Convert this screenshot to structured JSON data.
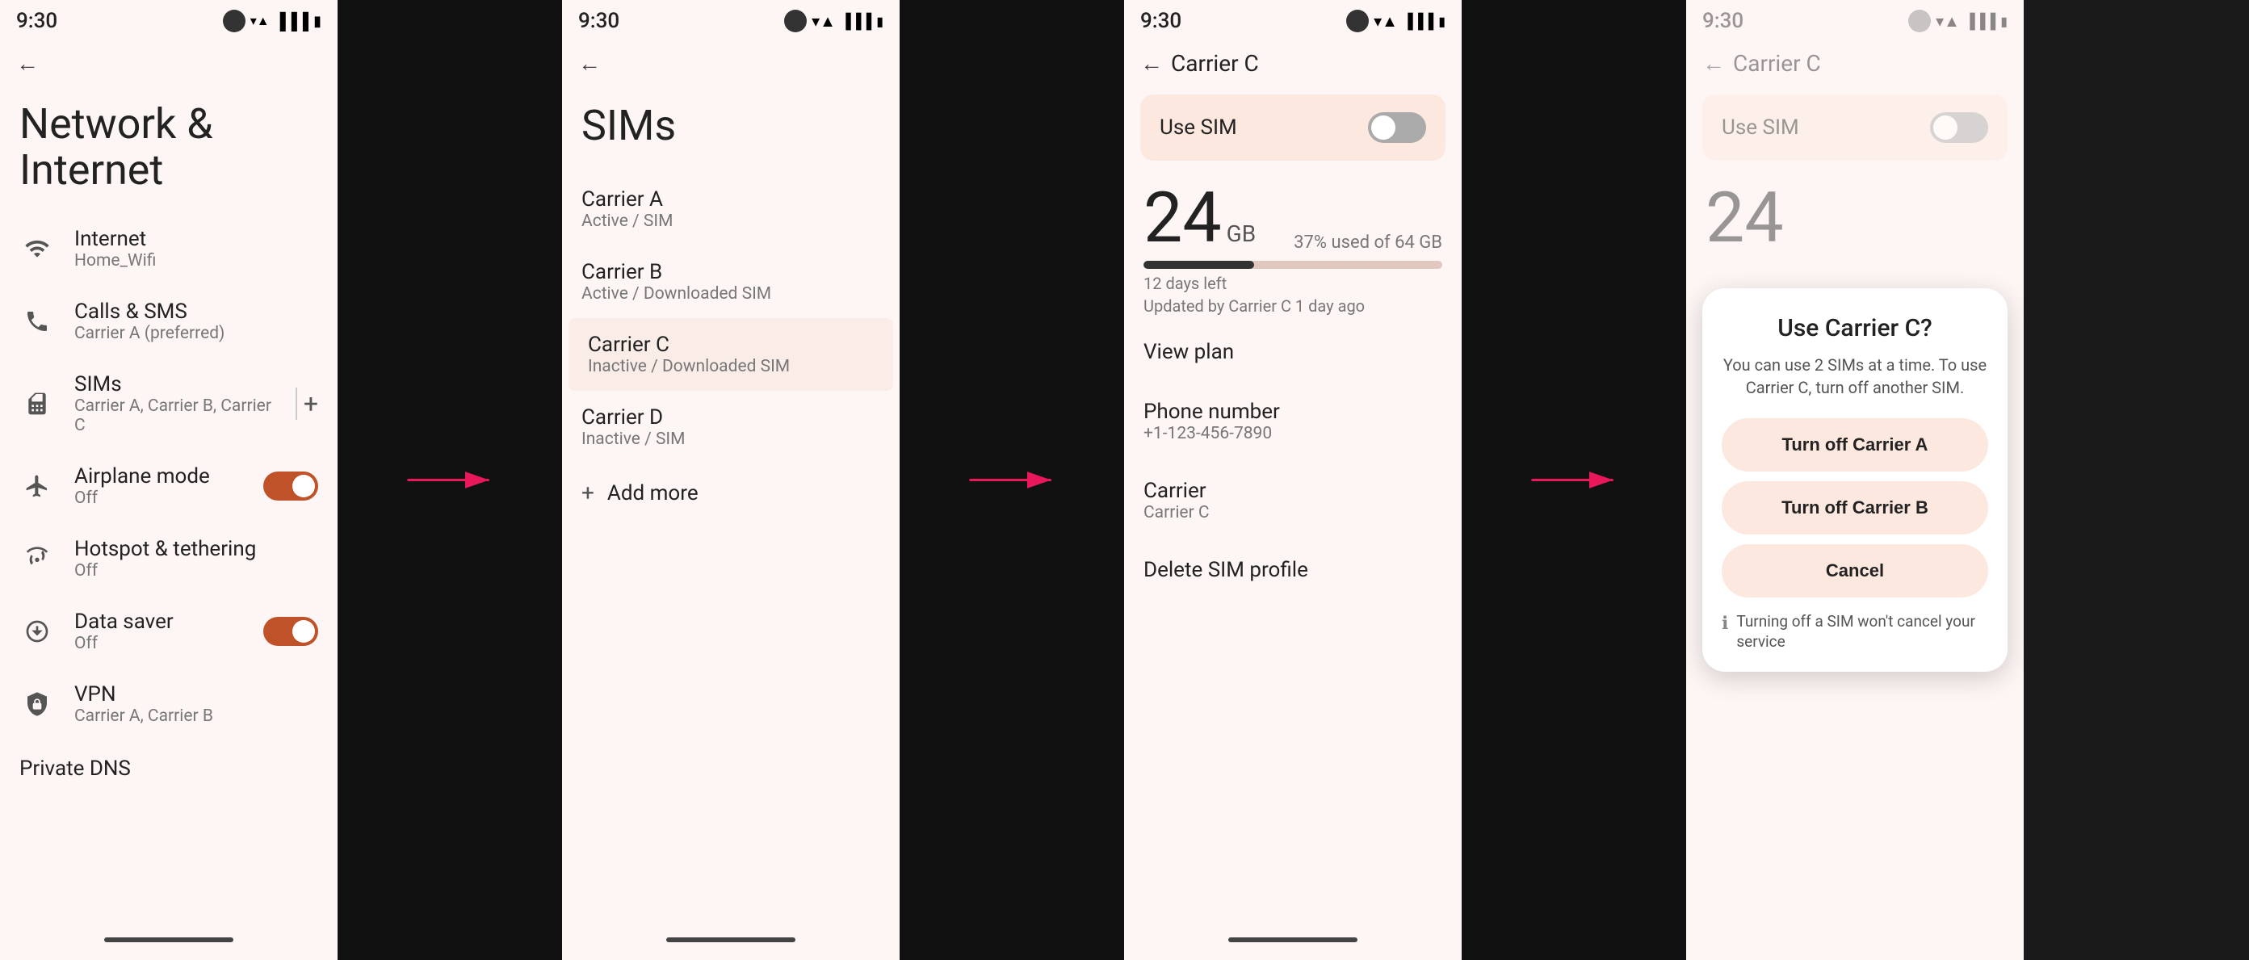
{
  "screens": {
    "screen1": {
      "status": {
        "time": "9:30"
      },
      "title": "Network & Internet",
      "menu_items": [
        {
          "id": "internet",
          "label": "Internet",
          "sub": "Home_Wifi",
          "icon": "wifi"
        },
        {
          "id": "calls-sms",
          "label": "Calls & SMS",
          "sub": "Carrier A (preferred)",
          "icon": "phone"
        },
        {
          "id": "sims",
          "label": "SIMs",
          "sub": "Carrier A, Carrier B, Carrier C",
          "icon": "sim"
        },
        {
          "id": "airplane",
          "label": "Airplane mode",
          "sub": "Off",
          "icon": "airplane",
          "toggle": true,
          "toggle_state": "on"
        },
        {
          "id": "hotspot",
          "label": "Hotspot & tethering",
          "sub": "Off",
          "icon": "hotspot"
        },
        {
          "id": "data-saver",
          "label": "Data saver",
          "sub": "Off",
          "icon": "data",
          "toggle": true,
          "toggle_state": "on"
        },
        {
          "id": "vpn",
          "label": "VPN",
          "sub": "Carrier A, Carrier B",
          "icon": "vpn"
        }
      ],
      "bottom_label": "Private DNS"
    },
    "screen2": {
      "status": {
        "time": "9:30"
      },
      "title": "SIMs",
      "sims": [
        {
          "name": "Carrier A",
          "status": "Active / SIM"
        },
        {
          "name": "Carrier B",
          "status": "Active / Downloaded SIM"
        },
        {
          "name": "Carrier C",
          "status": "Inactive / Downloaded SIM",
          "highlighted": true
        },
        {
          "name": "Carrier D",
          "status": "Inactive / SIM"
        }
      ],
      "add_more": "Add more"
    },
    "screen3": {
      "status": {
        "time": "9:30"
      },
      "back_label": "Carrier C",
      "use_sim": "Use SIM",
      "data_gb": "24",
      "data_unit": "GB",
      "data_percent": "37% used of 64 GB",
      "data_bar_pct": 37,
      "days_left": "12 days left",
      "updated": "Updated by Carrier C 1 day ago",
      "menu": [
        {
          "label": "View plan"
        },
        {
          "label": "Phone number",
          "sub": "+1-123-456-7890"
        },
        {
          "label": "Carrier",
          "sub": "Carrier C"
        },
        {
          "label": "Delete SIM profile"
        }
      ]
    },
    "screen4": {
      "status": {
        "time": "9:30"
      },
      "back_label": "Carrier C",
      "use_sim": "Use SIM",
      "data_gb": "24",
      "dialog": {
        "title": "Use Carrier C?",
        "desc": "You can use 2 SIMs at a time. To use Carrier C, turn off another SIM.",
        "btn1": "Turn off Carrier A",
        "btn2": "Turn off Carrier B",
        "btn3": "Cancel",
        "info": "Turning off a SIM won't cancel your service"
      }
    }
  },
  "arrows": {
    "arrow1_label": "→",
    "arrow2_label": "→"
  }
}
